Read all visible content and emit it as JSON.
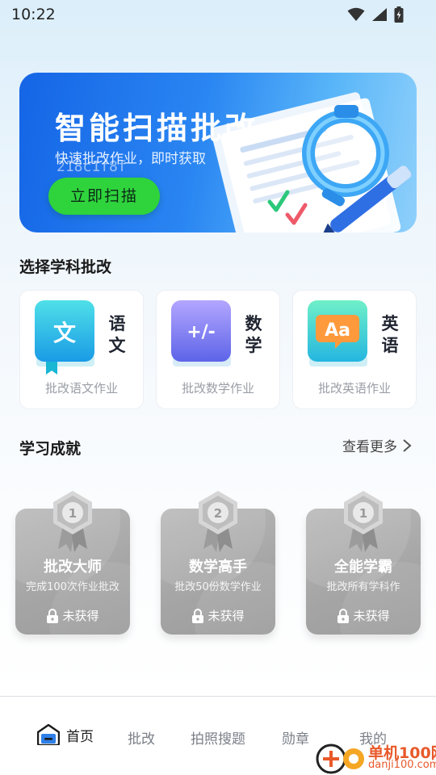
{
  "status_bar": {
    "time": "10:22"
  },
  "banner": {
    "title": "智能扫描批改",
    "subtitle": "快速批改作业，即时获取",
    "code": "218c1f8f",
    "button_label": "立即扫描"
  },
  "subjects_section": {
    "title": "选择学科批改"
  },
  "subjects": [
    {
      "name": "语文",
      "book_label": "文",
      "desc": "批改语文作业",
      "color": "#22c4d8"
    },
    {
      "name": "数学",
      "book_label": "+/-",
      "desc": "批改数学作业",
      "color": "#7a6cf0"
    },
    {
      "name": "英语",
      "book_label": "Aa",
      "desc": "批改英语作业",
      "color": "#3cc6d6"
    }
  ],
  "achievements_section": {
    "title": "学习成就",
    "see_more": "查看更多"
  },
  "achievements": [
    {
      "title": "批改大师",
      "desc": "完成100次作业批改",
      "status": "未获得",
      "medal": "1"
    },
    {
      "title": "数学高手",
      "desc": "批改50份数学作业",
      "status": "未获得",
      "medal": "2"
    },
    {
      "title": "全能学霸",
      "desc": "批改所有学科作",
      "status": "未获得",
      "medal": "1"
    }
  ],
  "bottom_nav": [
    {
      "label": "首页",
      "active": true
    },
    {
      "label": "批改",
      "active": false
    },
    {
      "label": "拍照搜题",
      "active": false
    },
    {
      "label": "勋章",
      "active": false
    },
    {
      "label": "我的",
      "active": false
    }
  ],
  "watermark": {
    "line1": "单机100网",
    "line2": "danji100.com"
  },
  "colors": {
    "primary": "#1565e6",
    "button_green": "#2fd33c",
    "locked_gray": "#a6a6a6"
  }
}
